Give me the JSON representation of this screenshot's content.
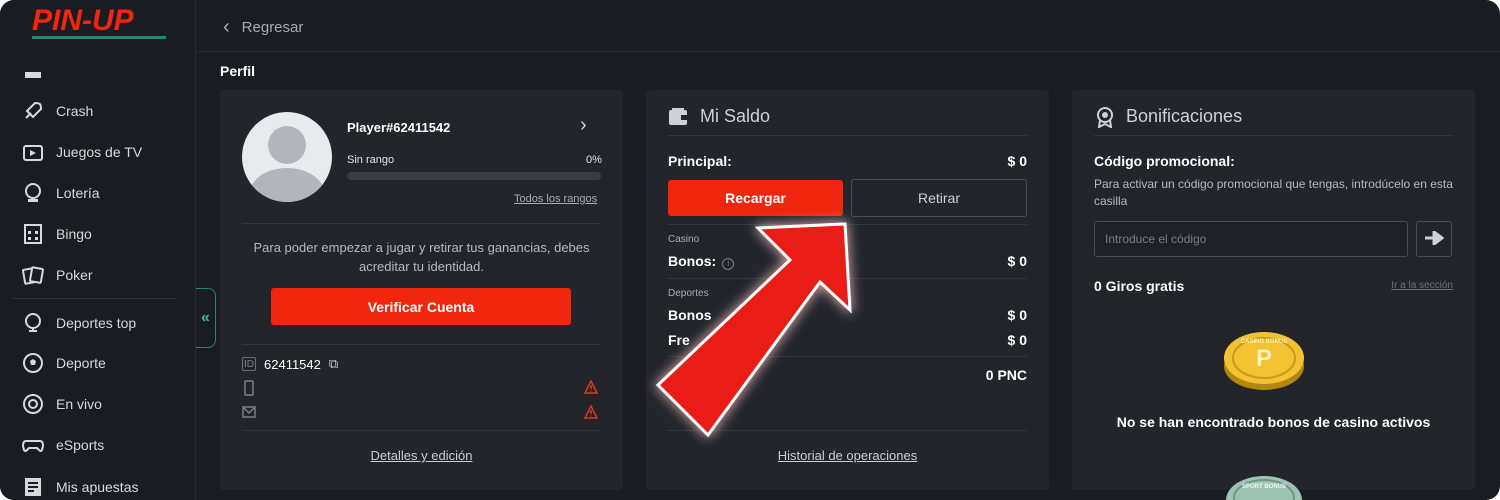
{
  "brand": {
    "logo_text": "PIN-UP"
  },
  "sidebar": {
    "items": [
      {
        "label": "Crash",
        "icon": "rocket-icon"
      },
      {
        "label": "Juegos de TV",
        "icon": "tv-icon"
      },
      {
        "label": "Lotería",
        "icon": "lottery-icon"
      },
      {
        "label": "Bingo",
        "icon": "bingo-icon"
      },
      {
        "label": "Poker",
        "icon": "cards-icon"
      },
      {
        "label": "Deportes top",
        "icon": "trophy-icon"
      },
      {
        "label": "Deporte",
        "icon": "soccer-ball-icon"
      },
      {
        "label": "En vivo",
        "icon": "live-icon"
      },
      {
        "label": "eSports",
        "icon": "gamepad-icon"
      },
      {
        "label": "Mis apuestas",
        "icon": "receipt-icon"
      }
    ],
    "collapse": "«"
  },
  "topbar": {
    "back_label": "Regresar"
  },
  "page": {
    "title": "Perfil"
  },
  "profile": {
    "player": "Player#62411542",
    "rank_label": "Sin rango",
    "rank_percent": "0%",
    "rank_progress": 0,
    "all_ranks": "Todos los rangos",
    "verify_text": "Para poder empezar a jugar y retirar tus ganancias, debes acreditar tu identidad.",
    "verify_button": "Verificar Cuenta",
    "id_tag": "ID",
    "id_value": "62411542",
    "details_link": "Detalles y edición"
  },
  "balance": {
    "title": "Mi Saldo",
    "main_label": "Principal:",
    "main_value": "$ 0",
    "recharge_button": "Recargar",
    "withdraw_button": "Retirar",
    "casino_label": "Casino",
    "casino_bonus_label": "Bonos:",
    "casino_bonus_value": "$ 0",
    "sports_label": "Deportes",
    "sports_bonus_label": "Bonos",
    "sports_bonus_value": "$ 0",
    "freebet_label": "Fre",
    "freebet_value": "$ 0",
    "pnc_value": "0 PNC",
    "history_link": "Historial de operaciones"
  },
  "bonus": {
    "title": "Bonificaciones",
    "promo_title": "Código promocional:",
    "promo_desc": "Para activar un código promocional que tengas, introdúcelo en esta casilla",
    "promo_placeholder": "Introduce el código",
    "spins": "0  Giros gratis",
    "goto_section": "Ir a la sección",
    "empty_text": "No se han encontrado bonos de casino activos",
    "coin_text": "CASINO BONUS",
    "coin2_text": "SPORT BONUS"
  },
  "colors": {
    "accent_red": "#f0260f",
    "accent_green": "#2bc29a",
    "background": "#1b1c21",
    "card": "#23252b"
  }
}
